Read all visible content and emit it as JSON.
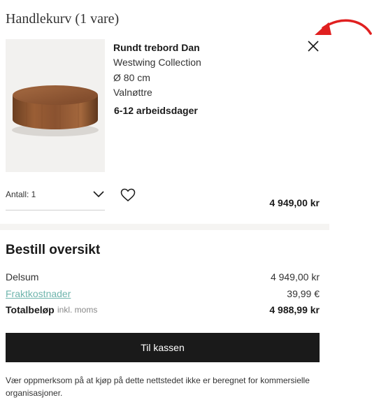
{
  "cart": {
    "title": "Handlekurv (1 vare)"
  },
  "product": {
    "name": "Rundt trebord Dan",
    "collection": "Westwing Collection",
    "size": "Ø 80 cm",
    "finish": "Valnøttre",
    "delivery": "6-12 arbeidsdager",
    "quantity_label": "Antall: 1",
    "price": "4 949,00 kr",
    "image_icon": "round-wood-coffee-table"
  },
  "summary": {
    "title": "Bestill oversikt",
    "subtotal_label": "Delsum",
    "subtotal_value": "4 949,00 kr",
    "shipping_label": "Fraktkostnader",
    "shipping_value": "39,99 €",
    "total_label": "Totalbeløp",
    "total_sublabel": "inkl. moms",
    "total_value": "4 988,99 kr"
  },
  "checkout": {
    "label": "Til kassen"
  },
  "notice": {
    "text": "Vær oppmerksom på at kjøp på dette nettstedet ikke er beregnet for kommersielle organisasjoner."
  },
  "colors": {
    "button_bg": "#1a1a1a",
    "link": "#6fb5ad",
    "annotation_arrow": "#e02020",
    "image_bg": "#f2f1ef"
  }
}
